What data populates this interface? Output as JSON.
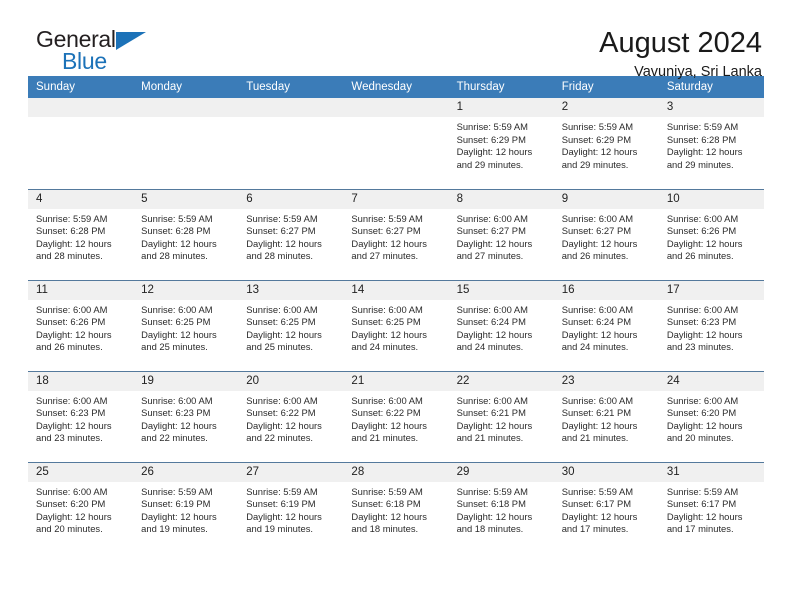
{
  "brand": {
    "name_top": "General",
    "name_bottom": "Blue",
    "triangle_color": "#1c72b8"
  },
  "header": {
    "title": "August 2024",
    "subtitle": "Vavuniya, Sri Lanka"
  },
  "colors": {
    "header_row_bg": "#3b7cb8",
    "header_row_text": "#ffffff",
    "daynum_bg": "#f0f0f0",
    "row_divider": "#54799c",
    "brand_blue": "#1c72b8"
  },
  "weekday_headers": [
    "Sunday",
    "Monday",
    "Tuesday",
    "Wednesday",
    "Thursday",
    "Friday",
    "Saturday"
  ],
  "weeks": [
    [
      {
        "day": "",
        "lines": []
      },
      {
        "day": "",
        "lines": []
      },
      {
        "day": "",
        "lines": []
      },
      {
        "day": "",
        "lines": []
      },
      {
        "day": "1",
        "lines": [
          "Sunrise: 5:59 AM",
          "Sunset: 6:29 PM",
          "Daylight: 12 hours",
          "and 29 minutes."
        ]
      },
      {
        "day": "2",
        "lines": [
          "Sunrise: 5:59 AM",
          "Sunset: 6:29 PM",
          "Daylight: 12 hours",
          "and 29 minutes."
        ]
      },
      {
        "day": "3",
        "lines": [
          "Sunrise: 5:59 AM",
          "Sunset: 6:28 PM",
          "Daylight: 12 hours",
          "and 29 minutes."
        ]
      }
    ],
    [
      {
        "day": "4",
        "lines": [
          "Sunrise: 5:59 AM",
          "Sunset: 6:28 PM",
          "Daylight: 12 hours",
          "and 28 minutes."
        ]
      },
      {
        "day": "5",
        "lines": [
          "Sunrise: 5:59 AM",
          "Sunset: 6:28 PM",
          "Daylight: 12 hours",
          "and 28 minutes."
        ]
      },
      {
        "day": "6",
        "lines": [
          "Sunrise: 5:59 AM",
          "Sunset: 6:27 PM",
          "Daylight: 12 hours",
          "and 28 minutes."
        ]
      },
      {
        "day": "7",
        "lines": [
          "Sunrise: 5:59 AM",
          "Sunset: 6:27 PM",
          "Daylight: 12 hours",
          "and 27 minutes."
        ]
      },
      {
        "day": "8",
        "lines": [
          "Sunrise: 6:00 AM",
          "Sunset: 6:27 PM",
          "Daylight: 12 hours",
          "and 27 minutes."
        ]
      },
      {
        "day": "9",
        "lines": [
          "Sunrise: 6:00 AM",
          "Sunset: 6:27 PM",
          "Daylight: 12 hours",
          "and 26 minutes."
        ]
      },
      {
        "day": "10",
        "lines": [
          "Sunrise: 6:00 AM",
          "Sunset: 6:26 PM",
          "Daylight: 12 hours",
          "and 26 minutes."
        ]
      }
    ],
    [
      {
        "day": "11",
        "lines": [
          "Sunrise: 6:00 AM",
          "Sunset: 6:26 PM",
          "Daylight: 12 hours",
          "and 26 minutes."
        ]
      },
      {
        "day": "12",
        "lines": [
          "Sunrise: 6:00 AM",
          "Sunset: 6:25 PM",
          "Daylight: 12 hours",
          "and 25 minutes."
        ]
      },
      {
        "day": "13",
        "lines": [
          "Sunrise: 6:00 AM",
          "Sunset: 6:25 PM",
          "Daylight: 12 hours",
          "and 25 minutes."
        ]
      },
      {
        "day": "14",
        "lines": [
          "Sunrise: 6:00 AM",
          "Sunset: 6:25 PM",
          "Daylight: 12 hours",
          "and 24 minutes."
        ]
      },
      {
        "day": "15",
        "lines": [
          "Sunrise: 6:00 AM",
          "Sunset: 6:24 PM",
          "Daylight: 12 hours",
          "and 24 minutes."
        ]
      },
      {
        "day": "16",
        "lines": [
          "Sunrise: 6:00 AM",
          "Sunset: 6:24 PM",
          "Daylight: 12 hours",
          "and 24 minutes."
        ]
      },
      {
        "day": "17",
        "lines": [
          "Sunrise: 6:00 AM",
          "Sunset: 6:23 PM",
          "Daylight: 12 hours",
          "and 23 minutes."
        ]
      }
    ],
    [
      {
        "day": "18",
        "lines": [
          "Sunrise: 6:00 AM",
          "Sunset: 6:23 PM",
          "Daylight: 12 hours",
          "and 23 minutes."
        ]
      },
      {
        "day": "19",
        "lines": [
          "Sunrise: 6:00 AM",
          "Sunset: 6:23 PM",
          "Daylight: 12 hours",
          "and 22 minutes."
        ]
      },
      {
        "day": "20",
        "lines": [
          "Sunrise: 6:00 AM",
          "Sunset: 6:22 PM",
          "Daylight: 12 hours",
          "and 22 minutes."
        ]
      },
      {
        "day": "21",
        "lines": [
          "Sunrise: 6:00 AM",
          "Sunset: 6:22 PM",
          "Daylight: 12 hours",
          "and 21 minutes."
        ]
      },
      {
        "day": "22",
        "lines": [
          "Sunrise: 6:00 AM",
          "Sunset: 6:21 PM",
          "Daylight: 12 hours",
          "and 21 minutes."
        ]
      },
      {
        "day": "23",
        "lines": [
          "Sunrise: 6:00 AM",
          "Sunset: 6:21 PM",
          "Daylight: 12 hours",
          "and 21 minutes."
        ]
      },
      {
        "day": "24",
        "lines": [
          "Sunrise: 6:00 AM",
          "Sunset: 6:20 PM",
          "Daylight: 12 hours",
          "and 20 minutes."
        ]
      }
    ],
    [
      {
        "day": "25",
        "lines": [
          "Sunrise: 6:00 AM",
          "Sunset: 6:20 PM",
          "Daylight: 12 hours",
          "and 20 minutes."
        ]
      },
      {
        "day": "26",
        "lines": [
          "Sunrise: 5:59 AM",
          "Sunset: 6:19 PM",
          "Daylight: 12 hours",
          "and 19 minutes."
        ]
      },
      {
        "day": "27",
        "lines": [
          "Sunrise: 5:59 AM",
          "Sunset: 6:19 PM",
          "Daylight: 12 hours",
          "and 19 minutes."
        ]
      },
      {
        "day": "28",
        "lines": [
          "Sunrise: 5:59 AM",
          "Sunset: 6:18 PM",
          "Daylight: 12 hours",
          "and 18 minutes."
        ]
      },
      {
        "day": "29",
        "lines": [
          "Sunrise: 5:59 AM",
          "Sunset: 6:18 PM",
          "Daylight: 12 hours",
          "and 18 minutes."
        ]
      },
      {
        "day": "30",
        "lines": [
          "Sunrise: 5:59 AM",
          "Sunset: 6:17 PM",
          "Daylight: 12 hours",
          "and 17 minutes."
        ]
      },
      {
        "day": "31",
        "lines": [
          "Sunrise: 5:59 AM",
          "Sunset: 6:17 PM",
          "Daylight: 12 hours",
          "and 17 minutes."
        ]
      }
    ]
  ]
}
